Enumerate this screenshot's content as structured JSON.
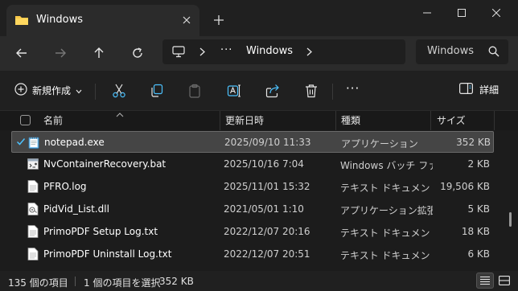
{
  "window": {
    "tab_title": "Windows",
    "new_tab_symbol": "+"
  },
  "nav": {
    "breadcrumb_more": "···",
    "breadcrumb_folder": "Windows",
    "search_placeholder": "Windows"
  },
  "commandbar": {
    "new_label": "新規作成",
    "details_label": "詳細",
    "more_symbol": "···"
  },
  "columns": {
    "name": "名前",
    "date": "更新日時",
    "type": "種類",
    "size": "サイズ"
  },
  "files": [
    {
      "name": "notepad.exe",
      "date": "2025/09/10 11:33",
      "type": "アプリケーション",
      "size": "352 KB",
      "icon": "notepad-icon",
      "selected": true
    },
    {
      "name": "NvContainerRecovery.bat",
      "date": "2025/10/16 7:04",
      "type": "Windows バッチ ファイル",
      "size": "2 KB",
      "icon": "batch-file-icon",
      "selected": false
    },
    {
      "name": "PFRO.log",
      "date": "2025/11/01 15:32",
      "type": "テキスト ドキュメント",
      "size": "19,506 KB",
      "icon": "text-file-icon",
      "selected": false
    },
    {
      "name": "PidVid_List.dll",
      "date": "2021/05/01 1:10",
      "type": "アプリケーション拡張",
      "size": "5 KB",
      "icon": "dll-file-icon",
      "selected": false
    },
    {
      "name": "PrimoPDF Setup Log.txt",
      "date": "2022/12/07 20:16",
      "type": "テキスト ドキュメント",
      "size": "18 KB",
      "icon": "text-file-icon",
      "selected": false
    },
    {
      "name": "PrimoPDF Uninstall Log.txt",
      "date": "2022/12/07 20:51",
      "type": "テキスト ドキュメント",
      "size": "6 KB",
      "icon": "text-file-icon",
      "selected": false
    }
  ],
  "status": {
    "item_count": "135 個の項目",
    "selection": "1 個の項目を選択",
    "selection_size": "352 KB"
  },
  "colors": {
    "accent": "#4cc2ff",
    "selected_row": "#454545",
    "folder": "#f8c84a"
  }
}
